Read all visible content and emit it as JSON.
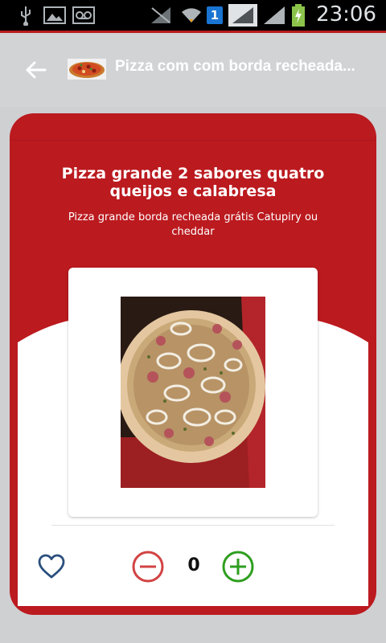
{
  "status_bar": {
    "time": "23:06",
    "icons": [
      "usb-icon",
      "image-icon",
      "voicemail-icon",
      "signal-muted-icon",
      "wifi-icon",
      "notification-badge-icon",
      "signal-full-icon",
      "signal-icon",
      "battery-charging-icon"
    ],
    "badge_number": "1"
  },
  "app_bar": {
    "title": "Pizza com com borda recheada..."
  },
  "product": {
    "title": "Pizza grande 2 sabores quatro queijos e calabresa",
    "description": "Pizza grande borda recheada grátis Catupiry ou cheddar"
  },
  "actions": {
    "quantity": "0"
  },
  "colors": {
    "accent_red": "#bb1a1f",
    "minus_color": "#d24343",
    "plus_color": "#2e9e1f",
    "heart_color": "#2a4f7d"
  }
}
